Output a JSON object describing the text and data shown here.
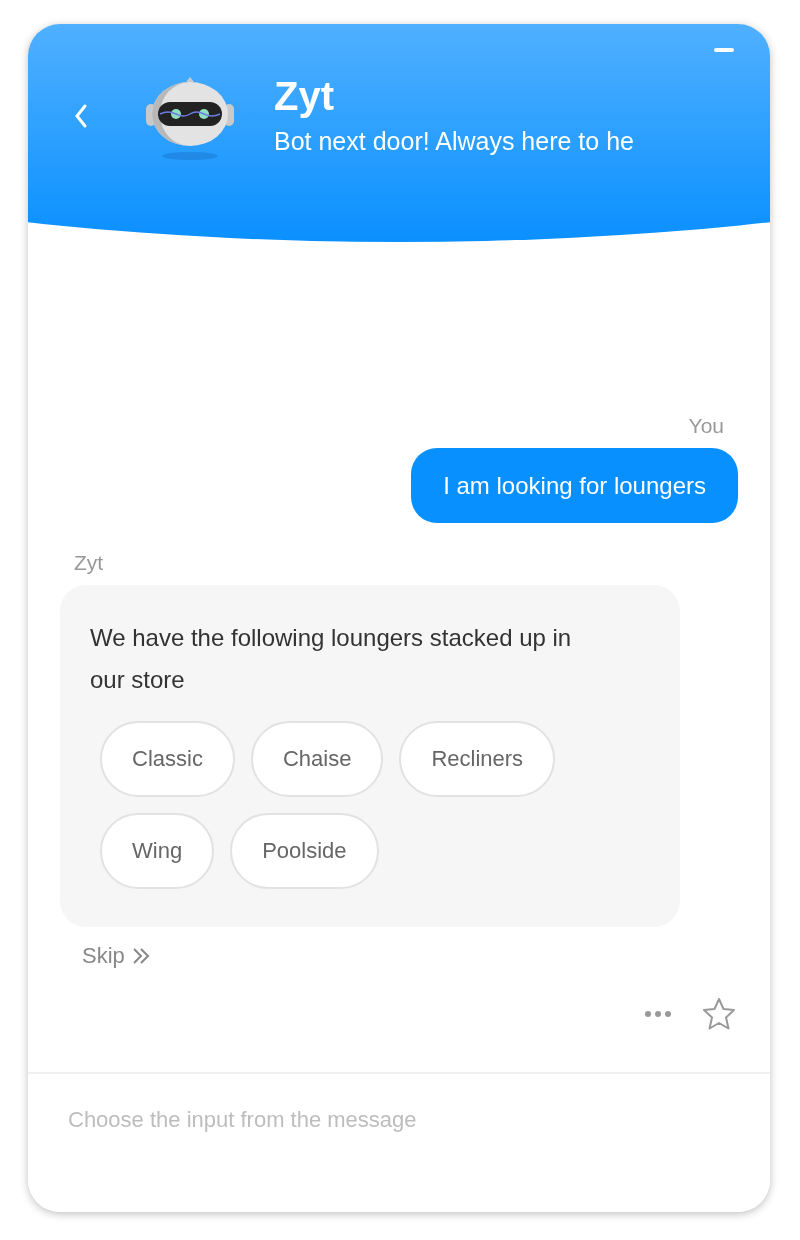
{
  "header": {
    "bot_name": "Zyt",
    "tagline": "Bot next door! Always here to he"
  },
  "messages": [
    {
      "kind": "user",
      "sender": "You",
      "text": "I am looking for loungers"
    },
    {
      "kind": "bot",
      "sender": "Zyt",
      "text": "We have the following loungers stacked up in our store",
      "options": [
        "Classic",
        "Chaise",
        "Recliners",
        "Wing",
        "Poolside"
      ]
    }
  ],
  "skip": {
    "label": "Skip"
  },
  "input": {
    "placeholder": "Choose the input from the message"
  }
}
